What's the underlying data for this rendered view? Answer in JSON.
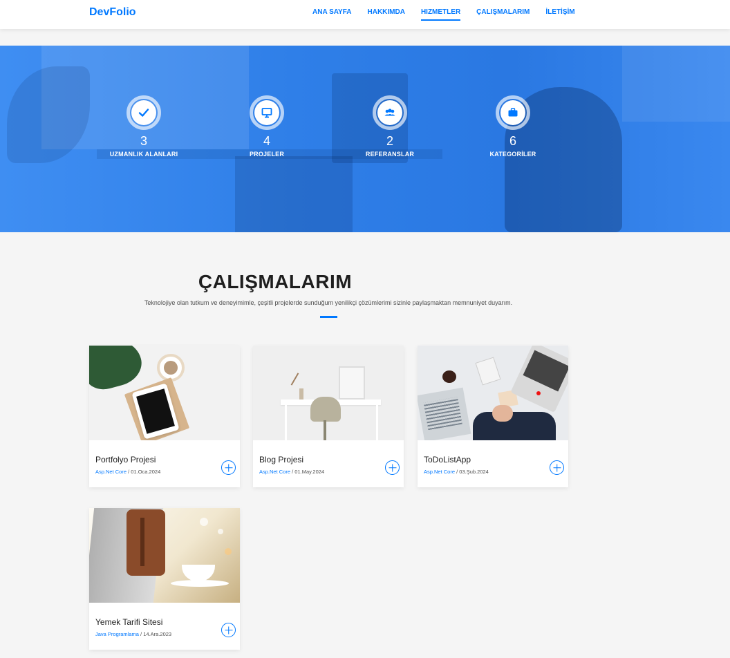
{
  "navbar": {
    "brand": "DevFolio",
    "links": [
      "ANA SAYFA",
      "HAKKIMDA",
      "HIZMETLER",
      "ÇALIŞMALARIM",
      "İLETİŞİM"
    ],
    "active_index": 2
  },
  "counters": [
    {
      "icon": "check-icon",
      "value": "3",
      "label": "UZMANLIK ALANLARI"
    },
    {
      "icon": "monitor-icon",
      "value": "4",
      "label": "PROJELER"
    },
    {
      "icon": "users-icon",
      "value": "2",
      "label": "REFERANSLAR"
    },
    {
      "icon": "briefcase-icon",
      "value": "6",
      "label": "KATEGORİLER"
    }
  ],
  "section": {
    "title": "ÇALIŞMALARIM",
    "subtitle": "Teknolojiye olan tutkum ve deneyimimle, çeşitli projelerde sunduğum yenilikçi çözümlerimi sizinle paylaşmaktan memnuniyet duyarım."
  },
  "works": [
    {
      "title": "Portfolyo Projesi",
      "category": "Asp.Net Core",
      "date": "01.Oca.2024"
    },
    {
      "title": "Blog Projesi",
      "category": "Asp.Net Core",
      "date": "01.May.2024"
    },
    {
      "title": "ToDoListApp",
      "category": "Asp.Net Core",
      "date": "03.Şub.2024"
    },
    {
      "title": "Yemek Tarifi Sitesi",
      "category": "Java Programlama",
      "date": "14.Ara.2023"
    }
  ],
  "colors": {
    "accent": "#0078ff",
    "hero": "#2f7fe8"
  }
}
